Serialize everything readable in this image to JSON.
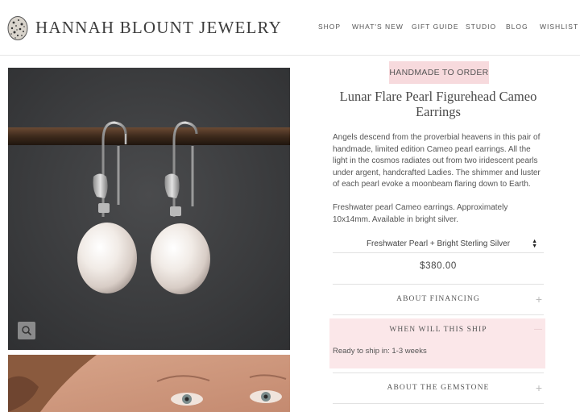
{
  "header": {
    "brand": "HANNAH BLOUNT JEWELRY",
    "nav": [
      {
        "label": "SHOP"
      },
      {
        "label": "WHAT'S NEW"
      },
      {
        "label": "GIFT GUIDE"
      },
      {
        "label": "STUDIO"
      },
      {
        "label": "BLOG"
      },
      {
        "label": "WISHLIST"
      }
    ]
  },
  "product": {
    "badge": "HANDMADE TO ORDER",
    "title": "Lunar Flare Pearl Figurehead Cameo Earrings",
    "description_1": "Angels descend from the proverbial heavens in this pair of handmade, limited edition Cameo pearl earrings. All the light in the cosmos radiates out from two iridescent pearls under argent, handcrafted Ladies. The shimmer and luster of each pearl evoke a moonbeam flaring down to Earth.",
    "description_2": "Freshwater pearl Cameo earrings. Approximately 10x14mm. Available in bright silver.",
    "variant": "Freshwater Pearl + Bright Sterling Silver",
    "price": "$380.00"
  },
  "accordion": {
    "financing": "ABOUT FINANCING",
    "ship": "WHEN WILL THIS SHIP",
    "ship_body": "Ready to ship in: 1-3 weeks",
    "gemstone": "ABOUT THE GEMSTONE",
    "plus": "+",
    "minus": "—"
  },
  "icons": {
    "zoom": "magnifier-icon",
    "logo": "speckled-egg-logo-icon",
    "select": "up-down-arrows-icon"
  },
  "colors": {
    "accent_pink": "#f7dadd",
    "open_panel": "#fbe7e9",
    "photo_bg": "#3b3c3e"
  }
}
